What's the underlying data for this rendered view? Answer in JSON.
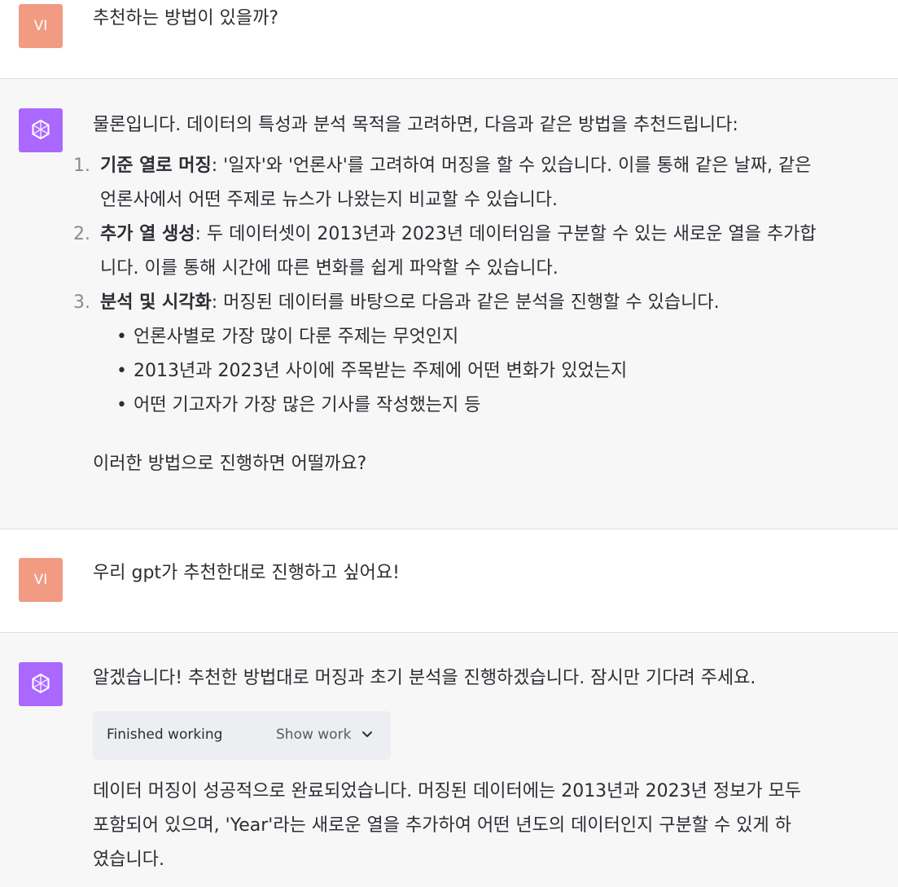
{
  "conversation": {
    "user_avatar_initials": "VI",
    "messages": [
      {
        "role": "user",
        "text": "추천하는 방법이 있을까?"
      },
      {
        "role": "assistant",
        "intro": "물론입니다. 데이터의 특성과 분석 목적을 고려하면, 다음과 같은 방법을 추천드립니다:",
        "steps": [
          {
            "num": "1.",
            "title": "기준 열로 머징",
            "line1": ": '일자'와 '언론사'를 고려하여 머징을 할 수 있습니다. 이를 통해 같은 날짜, 같은",
            "line2": "언론사에서 어떤 주제로 뉴스가 나왔는지 비교할 수 있습니다."
          },
          {
            "num": "2.",
            "title": "추가 열 생성",
            "line1": ": 두 데이터셋이 2013년과 2023년 데이터임을 구분할 수 있는 새로운 열을 추가합",
            "line2": "니다. 이를 통해 시간에 따른 변화를 쉽게 파악할 수 있습니다."
          },
          {
            "num": "3.",
            "title": "분석 및 시각화",
            "line1": ": 머징된 데이터를 바탕으로 다음과 같은 분석을 진행할 수 있습니다.",
            "bullets": [
              "언론사별로 가장 많이 다룬 주제는 무엇인지",
              "2013년과 2023년 사이에 주목받는 주제에 어떤 변화가 있었는지",
              "어떤 기고자가 가장 많은 기사를 작성했는지 등"
            ]
          }
        ],
        "closing": "이러한 방법으로 진행하면 어떨까요?"
      },
      {
        "role": "user",
        "text": "우리 gpt가 추천한대로 진행하고 싶어요!"
      },
      {
        "role": "assistant",
        "intro": "알겠습니다! 추천한 방법대로 머징과 초기 분석을 진행하겠습니다. 잠시만 기다려 주세요.",
        "work_status": "Finished working",
        "show_work_label": "Show work",
        "result_lines": [
          "데이터 머징이 성공적으로 완료되었습니다. 머징된 데이터에는 2013년과 2023년 정보가 모두",
          "포함되어 있으며, 'Year'라는 새로운 열을 추가하여 어떤 년도의 데이터인지 구분할 수 있게 하",
          "였습니다."
        ]
      }
    ]
  },
  "colors": {
    "user_avatar_bg": "#f19b83",
    "assistant_avatar_bg": "#ab68ff",
    "assistant_row_bg": "#f7f7f8",
    "work_box_bg": "#eceef1"
  },
  "icons": {
    "assistant_avatar": "openai-logo-icon",
    "show_work_chevron": "chevron-down-icon"
  }
}
